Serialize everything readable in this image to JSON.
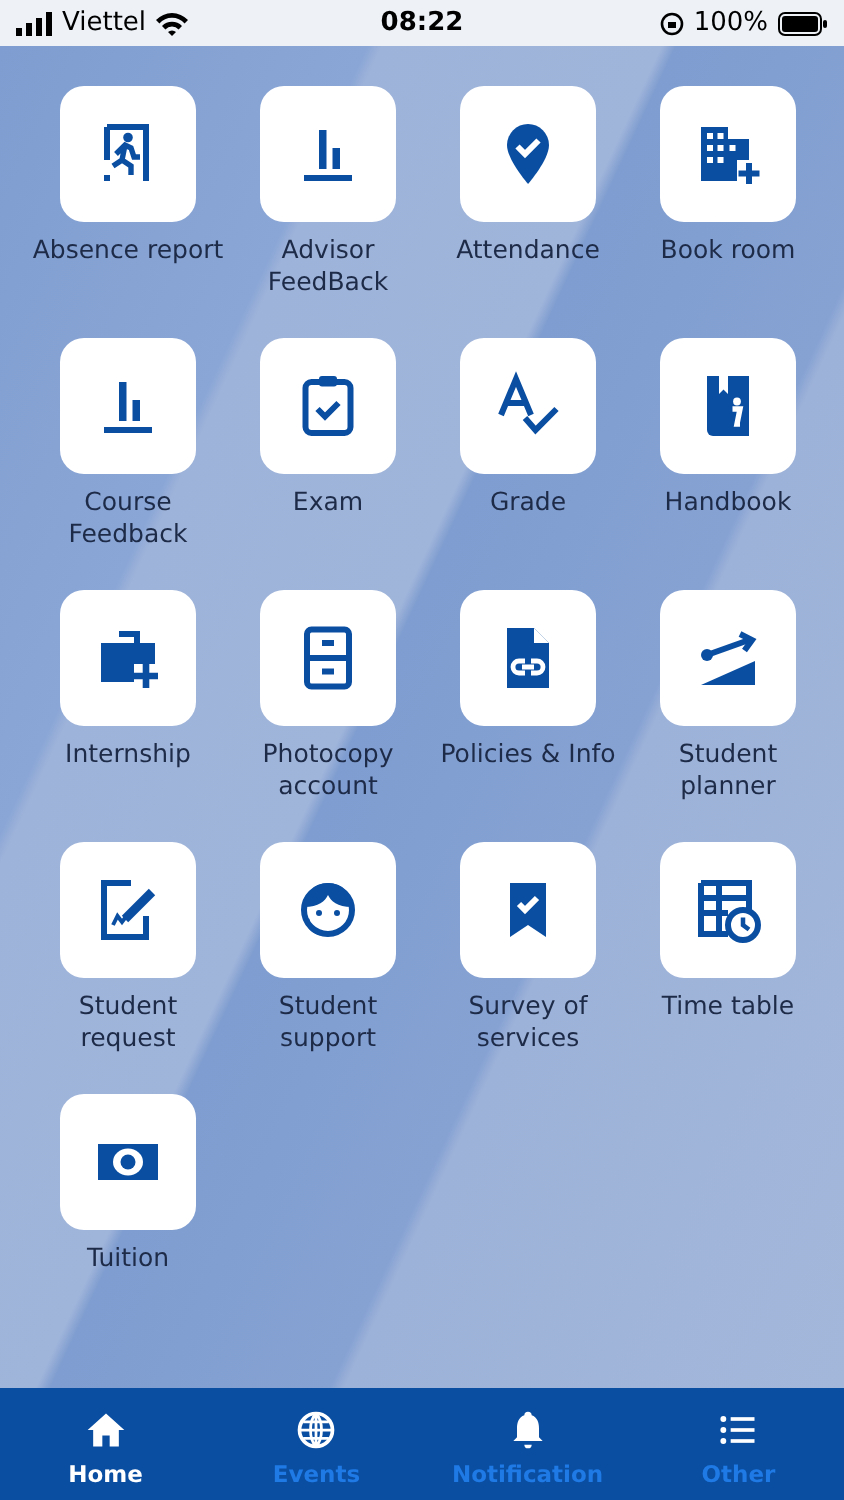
{
  "status_bar": {
    "carrier": "Viettel",
    "time": "08:22",
    "battery": "100%"
  },
  "apps": [
    {
      "label": "Absence report"
    },
    {
      "label": "Advisor FeedBack"
    },
    {
      "label": "Attendance"
    },
    {
      "label": "Book room"
    },
    {
      "label": "Course Feedback"
    },
    {
      "label": "Exam"
    },
    {
      "label": "Grade"
    },
    {
      "label": "Handbook"
    },
    {
      "label": "Internship"
    },
    {
      "label": "Photocopy account"
    },
    {
      "label": "Policies & Info"
    },
    {
      "label": "Student planner"
    },
    {
      "label": "Student request"
    },
    {
      "label": "Student support"
    },
    {
      "label": "Survey of services"
    },
    {
      "label": "Time table"
    },
    {
      "label": "Tuition"
    }
  ],
  "tab_bar": [
    {
      "label": "Home",
      "selected": true
    },
    {
      "label": "Events",
      "selected": false
    },
    {
      "label": "Notification",
      "selected": false
    },
    {
      "label": "Other",
      "selected": false
    }
  ]
}
